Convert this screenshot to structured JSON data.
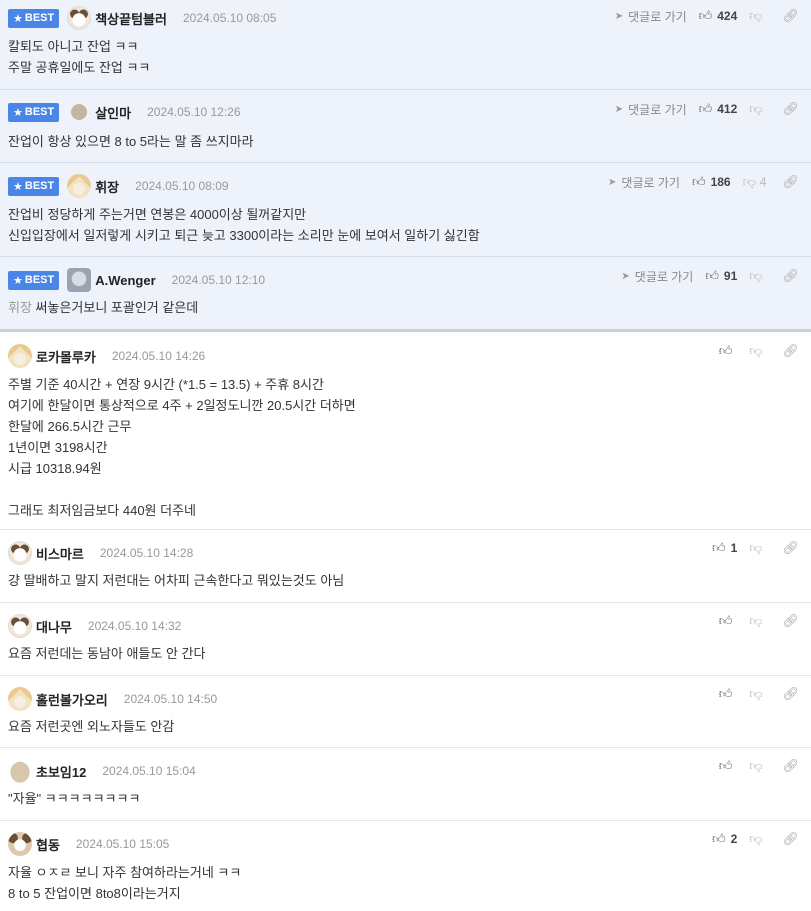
{
  "labels": {
    "best_badge": "BEST",
    "reply_link": "댓글로 가기"
  },
  "icons": {
    "star": "star-icon",
    "reply": "arrow-icon",
    "like": "thumbs-up-icon",
    "dislike": "thumbs-down-icon",
    "link": "link-icon"
  },
  "colors": {
    "best_bg": "#eef2fb",
    "badge": "#4a86e8"
  },
  "best_comments": [
    {
      "nick": "책상끝텀블러",
      "date": "2024.05.10 08:05",
      "likes": "424",
      "dislikes": "",
      "lines": [
        "칼퇴도 아니고 잔업 ㅋㅋ",
        "주말 공휴일에도 잔업 ㅋㅋ"
      ]
    },
    {
      "nick": "살인마",
      "date": "2024.05.10 12:26",
      "likes": "412",
      "dislikes": "",
      "lines": [
        "잔업이 항상 있으면 8 to 5라는 말 좀 쓰지마라"
      ]
    },
    {
      "nick": "휘장",
      "date": "2024.05.10 08:09",
      "likes": "186",
      "dislikes": "4",
      "lines": [
        "잔업비 정당하게 주는거면 연봉은 4000이상 될꺼같지만",
        "신입입장에서 일저렇게 시키고 퇴근 늦고 3300이라는 소리만 눈에 보여서 일하기 싫긴함"
      ]
    },
    {
      "nick": "A.Wenger",
      "date": "2024.05.10 12:10",
      "likes": "91",
      "dislikes": "",
      "mention": "휘장",
      "lines": [
        "써놓은거보니 포괄인거 같은데"
      ]
    }
  ],
  "comments": [
    {
      "nick": "로카몰루카",
      "date": "2024.05.10 14:26",
      "likes": "",
      "lines": [
        "주별 기준 40시간 + 연장 9시간 (*1.5 = 13.5) + 주휴 8시간",
        "여기에 한달이면 통상적으로 4주 + 2일정도니깐 20.5시간 더하면",
        "한달에 266.5시간 근무",
        "1년이면 3198시간",
        "시급 10318.94원",
        "",
        "그래도 최저임금보다 440원 더주네"
      ]
    },
    {
      "nick": "비스마르",
      "date": "2024.05.10 14:28",
      "likes": "1",
      "lines": [
        "걍 딸배하고 말지 저런대는 어차피 근속한다고 뭐있는것도 아님"
      ]
    },
    {
      "nick": "대나무",
      "date": "2024.05.10 14:32",
      "likes": "",
      "lines": [
        "요즘 저런데는 동남아 애들도 안 간다"
      ]
    },
    {
      "nick": "홀런볼가오리",
      "date": "2024.05.10 14:50",
      "likes": "",
      "lines": [
        "요즘 저런곳엔 외노자들도 안감"
      ]
    },
    {
      "nick": "초보임12",
      "date": "2024.05.10 15:04",
      "likes": "",
      "lines": [
        "\"자율\" ㅋㅋㅋㅋㅋㅋㅋㅋ"
      ]
    },
    {
      "nick": "협동",
      "date": "2024.05.10 15:05",
      "likes": "2",
      "lines": [
        "자율 ㅇㅈㄹ 보니 자주 참여하라는거네 ㅋㅋ",
        "8 to 5 잔업이면 8to8이라는거지"
      ]
    }
  ]
}
